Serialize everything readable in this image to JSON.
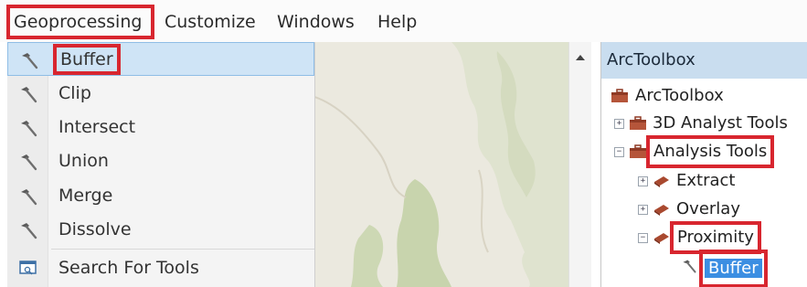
{
  "menubar": {
    "items": [
      {
        "label": "Geoprocessing"
      },
      {
        "label": "Customize"
      },
      {
        "label": "Windows"
      },
      {
        "label": "Help"
      }
    ]
  },
  "dropdown": {
    "items": [
      {
        "label": "Buffer",
        "icon": "hammer-icon"
      },
      {
        "label": "Clip",
        "icon": "hammer-icon"
      },
      {
        "label": "Intersect",
        "icon": "hammer-icon"
      },
      {
        "label": "Union",
        "icon": "hammer-icon"
      },
      {
        "label": "Merge",
        "icon": "hammer-icon"
      },
      {
        "label": "Dissolve",
        "icon": "hammer-icon"
      },
      {
        "label": "Search For Tools",
        "icon": "search-window-icon"
      }
    ]
  },
  "toolbox": {
    "title": "ArcToolbox",
    "tree": [
      {
        "label": "ArcToolbox",
        "icon": "toolbox-icon"
      },
      {
        "label": "3D Analyst Tools",
        "icon": "toolbox-icon",
        "expander": "+"
      },
      {
        "label": "Analysis Tools",
        "icon": "toolbox-icon",
        "expander": "−"
      },
      {
        "label": "Extract",
        "icon": "toolset-icon",
        "expander": "+"
      },
      {
        "label": "Overlay",
        "icon": "toolset-icon",
        "expander": "+"
      },
      {
        "label": "Proximity",
        "icon": "toolset-icon",
        "expander": "−"
      },
      {
        "label": "Buffer",
        "icon": "hammer-icon"
      }
    ]
  },
  "colors": {
    "highlight_red": "#d8262f",
    "selection_blue": "#3b8ee2",
    "panel_title_bg": "#c9ddef"
  }
}
